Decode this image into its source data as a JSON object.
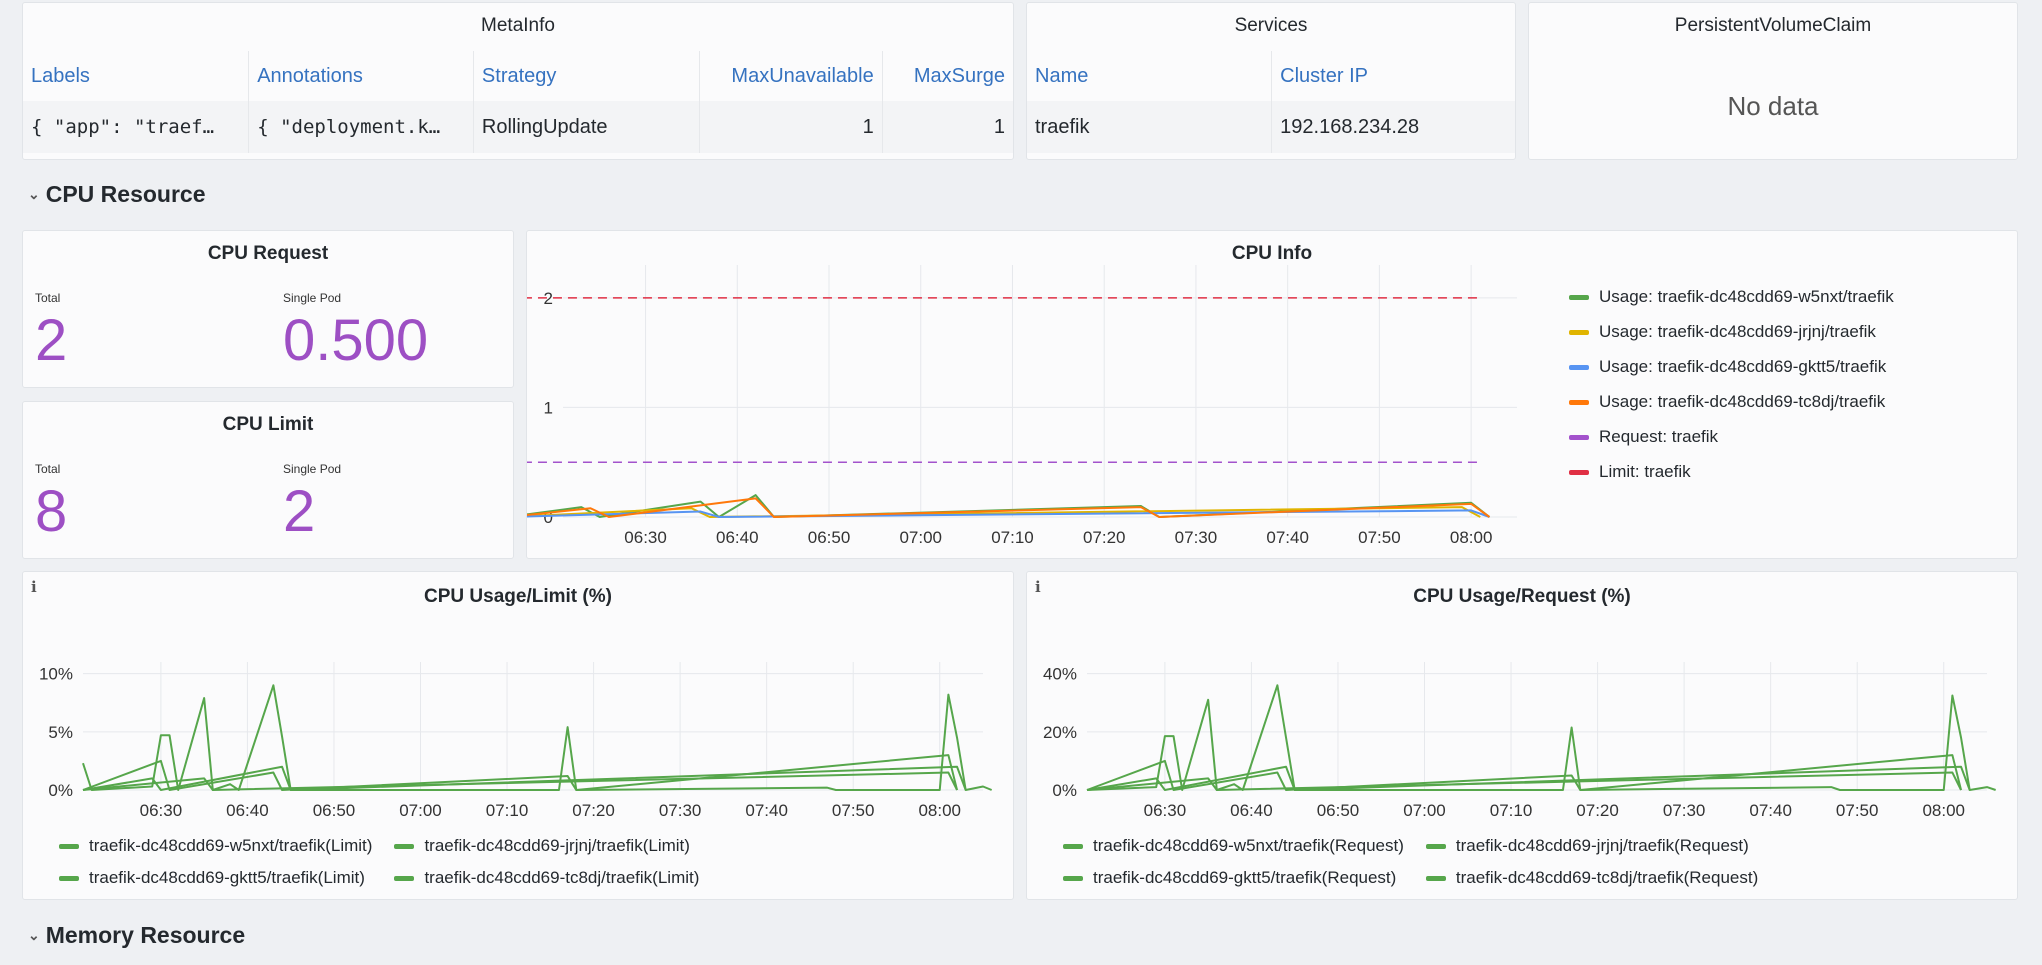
{
  "metainfo": {
    "title": "MetaInfo",
    "columns": [
      "Labels",
      "Annotations",
      "Strategy",
      "MaxUnavailable",
      "MaxSurge"
    ],
    "row": [
      "{ \"app\": \"traef…",
      "{ \"deployment.k…",
      "RollingUpdate",
      "1",
      "1"
    ]
  },
  "services": {
    "title": "Services",
    "columns": [
      "Name",
      "Cluster IP"
    ],
    "row": [
      "traefik",
      "192.168.234.28"
    ]
  },
  "pvc": {
    "title": "PersistentVolumeClaim",
    "message": "No data"
  },
  "sections": {
    "cpu": "CPU Resource",
    "memory": "Memory Resource"
  },
  "cpu_request": {
    "title": "CPU Request",
    "total_label": "Total",
    "total": "2",
    "single_label": "Single Pod",
    "single": "0.500"
  },
  "cpu_limit": {
    "title": "CPU Limit",
    "total_label": "Total",
    "total": "8",
    "single_label": "Single Pod",
    "single": "2"
  },
  "icons": {
    "collapse": "chevron-down-icon",
    "info": "info-icon"
  },
  "colors": {
    "green": "#56a64b",
    "yellow": "#e0b400",
    "blue": "#5794f2",
    "orange": "#ff780a",
    "purple": "#a352cc",
    "red": "#e02f44",
    "stat": "#9d4fc4"
  },
  "chart_data": [
    {
      "type": "line",
      "title": "CPU Info",
      "x_ticks": [
        "06:30",
        "06:40",
        "06:50",
        "07:00",
        "07:10",
        "07:20",
        "07:30",
        "07:40",
        "07:50",
        "08:00"
      ],
      "x_range": [
        "06:21",
        "08:05"
      ],
      "y_ticks": [
        "0",
        "1",
        "2"
      ],
      "ylim": [
        0,
        2.3
      ],
      "legend_position": "right",
      "series": [
        {
          "name": "Usage: traefik-dc48cdd69-w5nxt/traefik",
          "color": "#56a64b",
          "values": [
            [
              375,
              0
            ],
            [
              383,
              0.09
            ],
            [
              385,
              0
            ],
            [
              396,
              0.14
            ],
            [
              398,
              0
            ],
            [
              402,
              0.2
            ],
            [
              404,
              0
            ],
            [
              444,
              0.1
            ],
            [
              446,
              0
            ],
            [
              480,
              0.13
            ],
            [
              482,
              0
            ]
          ]
        },
        {
          "name": "Usage: traefik-dc48cdd69-jrjnj/traefik",
          "color": "#e0b400",
          "values": [
            [
              375,
              0
            ],
            [
              395,
              0.08
            ],
            [
              397,
              0
            ],
            [
              479,
              0.09
            ],
            [
              481,
              0
            ]
          ]
        },
        {
          "name": "Usage: traefik-dc48cdd69-gktt5/traefik",
          "color": "#5794f2",
          "values": [
            [
              375,
              0
            ],
            [
              396,
              0.05
            ],
            [
              398,
              0
            ],
            [
              480,
              0.06
            ],
            [
              482,
              0
            ]
          ]
        },
        {
          "name": "Usage: traefik-dc48cdd69-tc8dj/traefik",
          "color": "#ff780a",
          "values": [
            [
              375,
              0
            ],
            [
              384,
              0.08
            ],
            [
              386,
              0
            ],
            [
              402,
              0.17
            ],
            [
              404,
              0
            ],
            [
              444,
              0.09
            ],
            [
              446,
              0
            ],
            [
              480,
              0.12
            ],
            [
              482,
              0
            ]
          ]
        },
        {
          "name": "Request: traefik",
          "color": "#a352cc",
          "dashed": true,
          "values": [
            [
              375,
              0.5
            ],
            [
              481,
              0.5
            ]
          ]
        },
        {
          "name": "Limit: traefik",
          "color": "#e02f44",
          "dashed": true,
          "values": [
            [
              375,
              2
            ],
            [
              481,
              2
            ]
          ]
        }
      ]
    },
    {
      "type": "line",
      "title": "CPU Usage/Limit (%)",
      "x_ticks": [
        "06:30",
        "06:40",
        "06:50",
        "07:00",
        "07:10",
        "07:20",
        "07:30",
        "07:40",
        "07:50",
        "08:00"
      ],
      "x_range": [
        "06:21",
        "08:05"
      ],
      "y_ticks": [
        "0%",
        "5%",
        "10%"
      ],
      "ylim": [
        0,
        11
      ],
      "legend_position": "bottom",
      "series": [
        {
          "name": "traefik-dc48cdd69-w5nxt/traefik(Limit)",
          "color": "#56a64b",
          "values": [
            [
              381,
              2.3
            ],
            [
              382,
              0
            ],
            [
              389,
              0.3
            ],
            [
              390,
              4.7
            ],
            [
              391,
              4.7
            ],
            [
              392,
              0
            ],
            [
              395,
              7.9
            ],
            [
              396,
              0
            ],
            [
              398,
              0.5
            ],
            [
              399,
              0
            ],
            [
              403,
              9
            ],
            [
              404,
              4.6
            ],
            [
              405,
              0
            ],
            [
              436,
              0
            ],
            [
              437,
              5.4
            ],
            [
              438,
              0
            ],
            [
              467,
              0.2
            ],
            [
              468,
              0
            ],
            [
              480,
              0
            ],
            [
              481,
              8.2
            ],
            [
              482,
              4.5
            ],
            [
              483,
              0
            ],
            [
              485,
              0.3
            ],
            [
              486,
              0
            ]
          ]
        },
        {
          "name": "traefik-dc48cdd69-jrjnj/traefik(Limit)",
          "color": "#56a64b",
          "values": [
            [
              381,
              0
            ],
            [
              390,
              2.5
            ],
            [
              391,
              0
            ],
            [
              403,
              1.5
            ],
            [
              404,
              0
            ],
            [
              437,
              1.2
            ],
            [
              438,
              0
            ],
            [
              481,
              3
            ],
            [
              482,
              0
            ]
          ]
        },
        {
          "name": "traefik-dc48cdd69-gktt5/traefik(Limit)",
          "color": "#56a64b",
          "values": [
            [
              381,
              0
            ],
            [
              395,
              1
            ],
            [
              396,
              0
            ],
            [
              481,
              1.5
            ],
            [
              482,
              0
            ]
          ]
        },
        {
          "name": "traefik-dc48cdd69-tc8dj/traefik(Limit)",
          "color": "#56a64b",
          "values": [
            [
              381,
              0
            ],
            [
              389,
              1
            ],
            [
              390,
              0
            ],
            [
              404,
              2
            ],
            [
              405,
              0
            ],
            [
              482,
              2
            ],
            [
              483,
              0
            ]
          ]
        }
      ]
    },
    {
      "type": "line",
      "title": "CPU Usage/Request (%)",
      "x_ticks": [
        "06:30",
        "06:40",
        "06:50",
        "07:00",
        "07:10",
        "07:20",
        "07:30",
        "07:40",
        "07:50",
        "08:00"
      ],
      "x_range": [
        "06:21",
        "08:05"
      ],
      "y_ticks": [
        "0%",
        "20%",
        "40%"
      ],
      "ylim": [
        0,
        44
      ],
      "legend_position": "bottom",
      "series": [
        {
          "name": "traefik-dc48cdd69-w5nxt/traefik(Request)",
          "color": "#56a64b",
          "values": [
            [
              381,
              0
            ],
            [
              389,
              1
            ],
            [
              390,
              18.5
            ],
            [
              391,
              18.5
            ],
            [
              392,
              0
            ],
            [
              395,
              31
            ],
            [
              396,
              0
            ],
            [
              398,
              2
            ],
            [
              399,
              0
            ],
            [
              403,
              36
            ],
            [
              404,
              18
            ],
            [
              405,
              0
            ],
            [
              436,
              0
            ],
            [
              437,
              21.5
            ],
            [
              438,
              0
            ],
            [
              467,
              1
            ],
            [
              468,
              0
            ],
            [
              480,
              0
            ],
            [
              481,
              32.5
            ],
            [
              482,
              18
            ],
            [
              483,
              0
            ],
            [
              485,
              1
            ],
            [
              486,
              0
            ]
          ]
        },
        {
          "name": "traefik-dc48cdd69-jrjnj/traefik(Request)",
          "color": "#56a64b",
          "values": [
            [
              381,
              0
            ],
            [
              390,
              10
            ],
            [
              391,
              0
            ],
            [
              403,
              6
            ],
            [
              404,
              0
            ],
            [
              437,
              5
            ],
            [
              438,
              0
            ],
            [
              481,
              12
            ],
            [
              482,
              0
            ]
          ]
        },
        {
          "name": "traefik-dc48cdd69-gktt5/traefik(Request)",
          "color": "#56a64b",
          "values": [
            [
              381,
              0
            ],
            [
              395,
              4
            ],
            [
              396,
              0
            ],
            [
              481,
              6
            ],
            [
              482,
              0
            ]
          ]
        },
        {
          "name": "traefik-dc48cdd69-tc8dj/traefik(Request)",
          "color": "#56a64b",
          "values": [
            [
              381,
              0
            ],
            [
              389,
              4
            ],
            [
              390,
              0
            ],
            [
              404,
              8
            ],
            [
              405,
              0
            ],
            [
              482,
              8
            ],
            [
              483,
              0
            ]
          ]
        }
      ]
    }
  ]
}
